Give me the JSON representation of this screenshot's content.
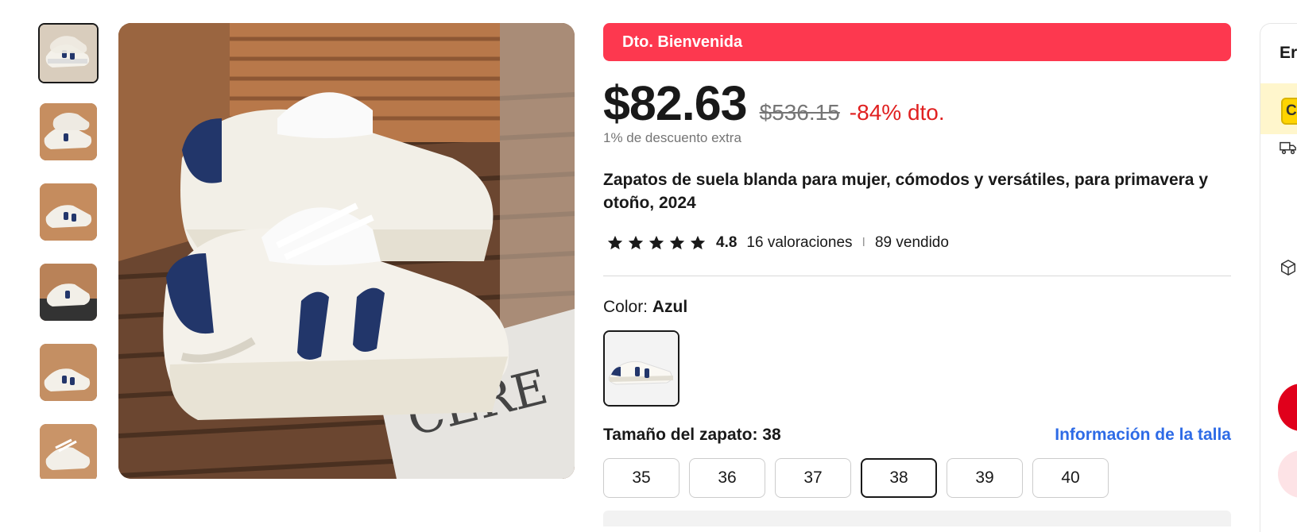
{
  "gallery": {
    "thumbnails": [
      {
        "alt": "product-thumbnail-1",
        "active": true
      },
      {
        "alt": "product-thumbnail-2",
        "active": false
      },
      {
        "alt": "product-thumbnail-3",
        "active": false
      },
      {
        "alt": "product-thumbnail-4",
        "active": false
      },
      {
        "alt": "product-thumbnail-5",
        "active": false
      },
      {
        "alt": "product-thumbnail-6",
        "active": false
      }
    ],
    "main_image_text": "CERE"
  },
  "product": {
    "promo_banner": "Dto. Bienvenida",
    "price": "$82.63",
    "original_price": "$536.15",
    "discount": "-84% dto.",
    "extra_discount": "1% de descuento extra",
    "title": "Zapatos de suela blanda para mujer, cómodos y versátiles, para primavera y otoño, 2024",
    "rating": "4.8",
    "reviews": "16 valoraciones",
    "separator": "I",
    "sold": "89 vendido",
    "stars": 5,
    "color_label": "Color:",
    "color_value": "Azul",
    "size_label": "Tamaño del zapato: 38",
    "size_info_link": "Información de la talla",
    "sizes": [
      "35",
      "36",
      "37",
      "38",
      "39",
      "40"
    ],
    "selected_size": "38"
  },
  "right_panel": {
    "text_partial": "Er",
    "coupon_partial": "C"
  },
  "colors": {
    "promo_red": "#fd384f",
    "discount_red": "#e02020",
    "link_blue": "#2e6be6",
    "accent_red": "#e0001b"
  }
}
